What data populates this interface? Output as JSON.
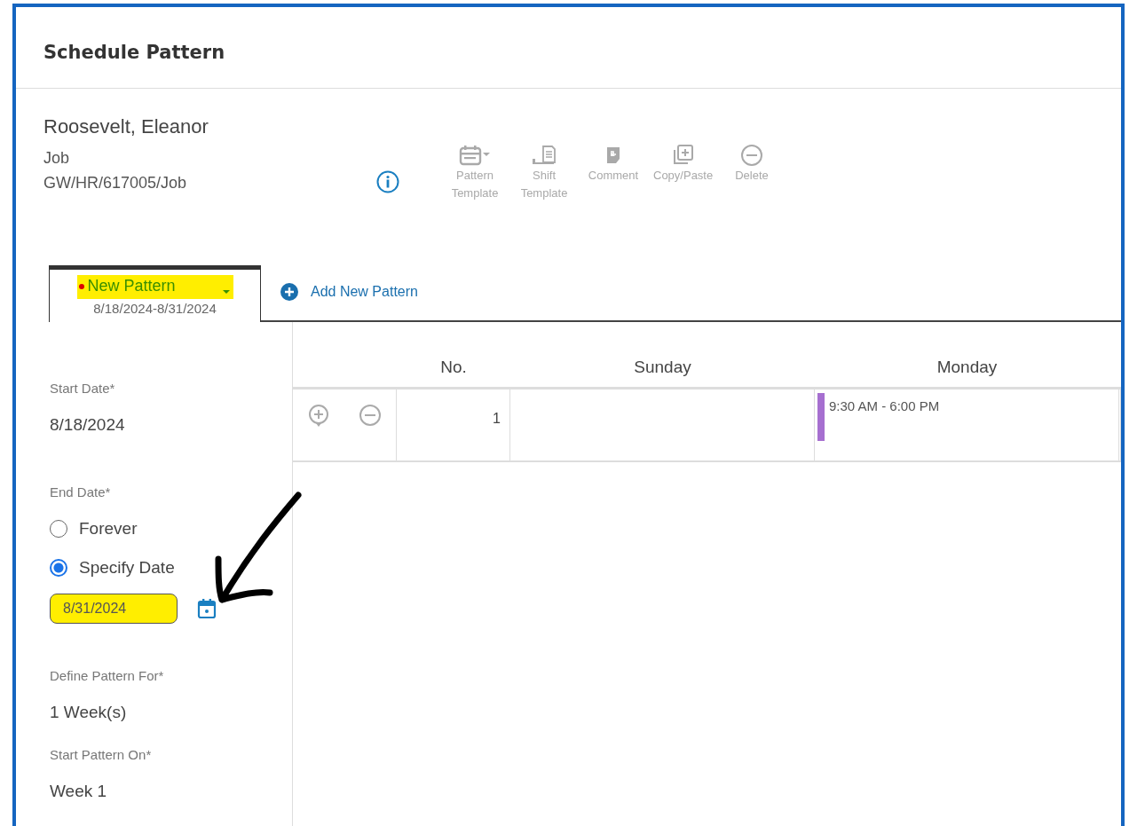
{
  "window": {
    "title": "Schedule Pattern"
  },
  "employee": {
    "name": "Roosevelt, Eleanor",
    "type": "Job",
    "path": "GW/HR/617005/Job"
  },
  "toolbar": [
    {
      "label": "Pattern Template",
      "kind": "pattern",
      "disabled": true
    },
    {
      "label": "Shift Template",
      "kind": "shift",
      "disabled": true
    },
    {
      "label": "Comment",
      "kind": "comment",
      "disabled": true
    },
    {
      "label": "Copy/Paste",
      "kind": "copy",
      "disabled": true
    },
    {
      "label": "Delete",
      "kind": "delete",
      "disabled": true
    }
  ],
  "tabs": [
    {
      "title": "New Pattern",
      "dates": "8/18/2024-8/31/2024",
      "selected": true,
      "unsaved": true,
      "highlighted": true
    }
  ],
  "add_pattern": "Add New Pattern",
  "form": {
    "start_date_label": "Start Date*",
    "start_date": "8/18/2024",
    "end_date_label": "End Date*",
    "end_options": [
      {
        "label": "Forever",
        "selected": false
      },
      {
        "label": "Specify Date",
        "selected": true
      }
    ],
    "end_date": {
      "value": "8/31/2024",
      "highlighted": true
    },
    "define_label": "Define Pattern For*",
    "define_value": "1 Week(s)",
    "start_on_label": "Start Pattern On*",
    "start_on_value": "Week 1"
  },
  "grid": {
    "columns": [
      "No.",
      "Sunday",
      "Monday"
    ],
    "rows": [
      {
        "no": "1",
        "monday_shifts": [
          {
            "time": "9:30 AM - 6:00 PM",
            "color": "#a66fd0"
          }
        ]
      }
    ]
  }
}
